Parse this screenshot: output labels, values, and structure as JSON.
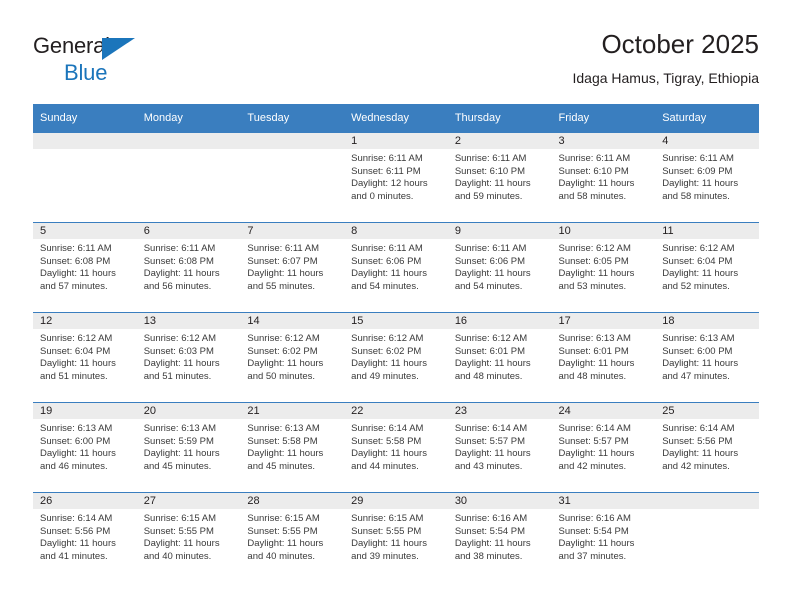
{
  "brand": {
    "name_part1": "General",
    "name_part2": "Blue",
    "mark": "triangle-logo",
    "color_dark": "#231f20",
    "color_blue": "#1b75bb"
  },
  "header": {
    "title": "October 2025",
    "subtitle": "Idaga Hamus, Tigray, Ethiopia"
  },
  "theme": {
    "header_row_bg": "#3a7ebf",
    "daynum_bg": "#ececec",
    "grid_line": "#3a7ebf",
    "text": "#231f20"
  },
  "calendar": {
    "weekday_headers": [
      "Sunday",
      "Monday",
      "Tuesday",
      "Wednesday",
      "Thursday",
      "Friday",
      "Saturday"
    ],
    "weeks": [
      [
        {
          "day": "",
          "sunrise": "",
          "sunset": "",
          "daylight_1": "",
          "daylight_2": ""
        },
        {
          "day": "",
          "sunrise": "",
          "sunset": "",
          "daylight_1": "",
          "daylight_2": ""
        },
        {
          "day": "",
          "sunrise": "",
          "sunset": "",
          "daylight_1": "",
          "daylight_2": ""
        },
        {
          "day": "1",
          "sunrise": "Sunrise: 6:11 AM",
          "sunset": "Sunset: 6:11 PM",
          "daylight_1": "Daylight: 12 hours",
          "daylight_2": "and 0 minutes."
        },
        {
          "day": "2",
          "sunrise": "Sunrise: 6:11 AM",
          "sunset": "Sunset: 6:10 PM",
          "daylight_1": "Daylight: 11 hours",
          "daylight_2": "and 59 minutes."
        },
        {
          "day": "3",
          "sunrise": "Sunrise: 6:11 AM",
          "sunset": "Sunset: 6:10 PM",
          "daylight_1": "Daylight: 11 hours",
          "daylight_2": "and 58 minutes."
        },
        {
          "day": "4",
          "sunrise": "Sunrise: 6:11 AM",
          "sunset": "Sunset: 6:09 PM",
          "daylight_1": "Daylight: 11 hours",
          "daylight_2": "and 58 minutes."
        }
      ],
      [
        {
          "day": "5",
          "sunrise": "Sunrise: 6:11 AM",
          "sunset": "Sunset: 6:08 PM",
          "daylight_1": "Daylight: 11 hours",
          "daylight_2": "and 57 minutes."
        },
        {
          "day": "6",
          "sunrise": "Sunrise: 6:11 AM",
          "sunset": "Sunset: 6:08 PM",
          "daylight_1": "Daylight: 11 hours",
          "daylight_2": "and 56 minutes."
        },
        {
          "day": "7",
          "sunrise": "Sunrise: 6:11 AM",
          "sunset": "Sunset: 6:07 PM",
          "daylight_1": "Daylight: 11 hours",
          "daylight_2": "and 55 minutes."
        },
        {
          "day": "8",
          "sunrise": "Sunrise: 6:11 AM",
          "sunset": "Sunset: 6:06 PM",
          "daylight_1": "Daylight: 11 hours",
          "daylight_2": "and 54 minutes."
        },
        {
          "day": "9",
          "sunrise": "Sunrise: 6:11 AM",
          "sunset": "Sunset: 6:06 PM",
          "daylight_1": "Daylight: 11 hours",
          "daylight_2": "and 54 minutes."
        },
        {
          "day": "10",
          "sunrise": "Sunrise: 6:12 AM",
          "sunset": "Sunset: 6:05 PM",
          "daylight_1": "Daylight: 11 hours",
          "daylight_2": "and 53 minutes."
        },
        {
          "day": "11",
          "sunrise": "Sunrise: 6:12 AM",
          "sunset": "Sunset: 6:04 PM",
          "daylight_1": "Daylight: 11 hours",
          "daylight_2": "and 52 minutes."
        }
      ],
      [
        {
          "day": "12",
          "sunrise": "Sunrise: 6:12 AM",
          "sunset": "Sunset: 6:04 PM",
          "daylight_1": "Daylight: 11 hours",
          "daylight_2": "and 51 minutes."
        },
        {
          "day": "13",
          "sunrise": "Sunrise: 6:12 AM",
          "sunset": "Sunset: 6:03 PM",
          "daylight_1": "Daylight: 11 hours",
          "daylight_2": "and 51 minutes."
        },
        {
          "day": "14",
          "sunrise": "Sunrise: 6:12 AM",
          "sunset": "Sunset: 6:02 PM",
          "daylight_1": "Daylight: 11 hours",
          "daylight_2": "and 50 minutes."
        },
        {
          "day": "15",
          "sunrise": "Sunrise: 6:12 AM",
          "sunset": "Sunset: 6:02 PM",
          "daylight_1": "Daylight: 11 hours",
          "daylight_2": "and 49 minutes."
        },
        {
          "day": "16",
          "sunrise": "Sunrise: 6:12 AM",
          "sunset": "Sunset: 6:01 PM",
          "daylight_1": "Daylight: 11 hours",
          "daylight_2": "and 48 minutes."
        },
        {
          "day": "17",
          "sunrise": "Sunrise: 6:13 AM",
          "sunset": "Sunset: 6:01 PM",
          "daylight_1": "Daylight: 11 hours",
          "daylight_2": "and 48 minutes."
        },
        {
          "day": "18",
          "sunrise": "Sunrise: 6:13 AM",
          "sunset": "Sunset: 6:00 PM",
          "daylight_1": "Daylight: 11 hours",
          "daylight_2": "and 47 minutes."
        }
      ],
      [
        {
          "day": "19",
          "sunrise": "Sunrise: 6:13 AM",
          "sunset": "Sunset: 6:00 PM",
          "daylight_1": "Daylight: 11 hours",
          "daylight_2": "and 46 minutes."
        },
        {
          "day": "20",
          "sunrise": "Sunrise: 6:13 AM",
          "sunset": "Sunset: 5:59 PM",
          "daylight_1": "Daylight: 11 hours",
          "daylight_2": "and 45 minutes."
        },
        {
          "day": "21",
          "sunrise": "Sunrise: 6:13 AM",
          "sunset": "Sunset: 5:58 PM",
          "daylight_1": "Daylight: 11 hours",
          "daylight_2": "and 45 minutes."
        },
        {
          "day": "22",
          "sunrise": "Sunrise: 6:14 AM",
          "sunset": "Sunset: 5:58 PM",
          "daylight_1": "Daylight: 11 hours",
          "daylight_2": "and 44 minutes."
        },
        {
          "day": "23",
          "sunrise": "Sunrise: 6:14 AM",
          "sunset": "Sunset: 5:57 PM",
          "daylight_1": "Daylight: 11 hours",
          "daylight_2": "and 43 minutes."
        },
        {
          "day": "24",
          "sunrise": "Sunrise: 6:14 AM",
          "sunset": "Sunset: 5:57 PM",
          "daylight_1": "Daylight: 11 hours",
          "daylight_2": "and 42 minutes."
        },
        {
          "day": "25",
          "sunrise": "Sunrise: 6:14 AM",
          "sunset": "Sunset: 5:56 PM",
          "daylight_1": "Daylight: 11 hours",
          "daylight_2": "and 42 minutes."
        }
      ],
      [
        {
          "day": "26",
          "sunrise": "Sunrise: 6:14 AM",
          "sunset": "Sunset: 5:56 PM",
          "daylight_1": "Daylight: 11 hours",
          "daylight_2": "and 41 minutes."
        },
        {
          "day": "27",
          "sunrise": "Sunrise: 6:15 AM",
          "sunset": "Sunset: 5:55 PM",
          "daylight_1": "Daylight: 11 hours",
          "daylight_2": "and 40 minutes."
        },
        {
          "day": "28",
          "sunrise": "Sunrise: 6:15 AM",
          "sunset": "Sunset: 5:55 PM",
          "daylight_1": "Daylight: 11 hours",
          "daylight_2": "and 40 minutes."
        },
        {
          "day": "29",
          "sunrise": "Sunrise: 6:15 AM",
          "sunset": "Sunset: 5:55 PM",
          "daylight_1": "Daylight: 11 hours",
          "daylight_2": "and 39 minutes."
        },
        {
          "day": "30",
          "sunrise": "Sunrise: 6:16 AM",
          "sunset": "Sunset: 5:54 PM",
          "daylight_1": "Daylight: 11 hours",
          "daylight_2": "and 38 minutes."
        },
        {
          "day": "31",
          "sunrise": "Sunrise: 6:16 AM",
          "sunset": "Sunset: 5:54 PM",
          "daylight_1": "Daylight: 11 hours",
          "daylight_2": "and 37 minutes."
        },
        {
          "day": "",
          "sunrise": "",
          "sunset": "",
          "daylight_1": "",
          "daylight_2": ""
        }
      ]
    ]
  }
}
